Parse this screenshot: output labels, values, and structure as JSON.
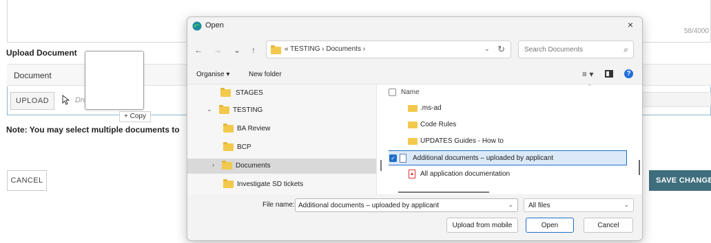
{
  "form": {
    "char_count": "58/4000",
    "upload_title": "Upload Document",
    "doc_header": "Document",
    "upload_button": "UPLOAD",
    "drop_placeholder": "Drop files here",
    "note": "Note: You may select multiple documents to",
    "cancel_button": "CANCEL",
    "save_button": "SAVE CHANGES"
  },
  "drag": {
    "badge": "+ Copy"
  },
  "dialog": {
    "title": "Open",
    "close": "×",
    "nav": {
      "back": "←",
      "forward": "→",
      "recent": "⌄",
      "up": "↑"
    },
    "address_path": "« TESTING › Documents ›",
    "search_placeholder": "Search Documents",
    "toolbar": {
      "organise": "Organise ▾",
      "new_folder": "New folder",
      "help": "?"
    },
    "tree": [
      {
        "label": "STAGES",
        "chevron": ""
      },
      {
        "label": "TESTING",
        "chevron": "⌄"
      },
      {
        "label": "BA Review",
        "chevron": ""
      },
      {
        "label": "BCP",
        "chevron": ""
      },
      {
        "label": "Documents",
        "chevron": "›"
      },
      {
        "label": "Investigate SD tickets",
        "chevron": ""
      }
    ],
    "list_header": "Name",
    "files": [
      {
        "name": ".ms-ad",
        "type": "folder"
      },
      {
        "name": "Code Rules",
        "type": "folder"
      },
      {
        "name": "UPDATES Guides - How to",
        "type": "folder"
      },
      {
        "name": "Additional documents – uploaded by applicant",
        "type": "document",
        "selected": true
      },
      {
        "name": "All application documentation",
        "type": "pdf"
      }
    ],
    "file_name_label": "File name:",
    "file_name_value": "Additional documents – uploaded by applicant",
    "file_type": "All files",
    "buttons": {
      "upload_mobile": "Upload from mobile",
      "open": "Open",
      "cancel": "Cancel"
    }
  },
  "colors": {
    "accent": "#1f6fc7",
    "save_button": "#3f6e7c",
    "folder": "#f2c94c"
  }
}
